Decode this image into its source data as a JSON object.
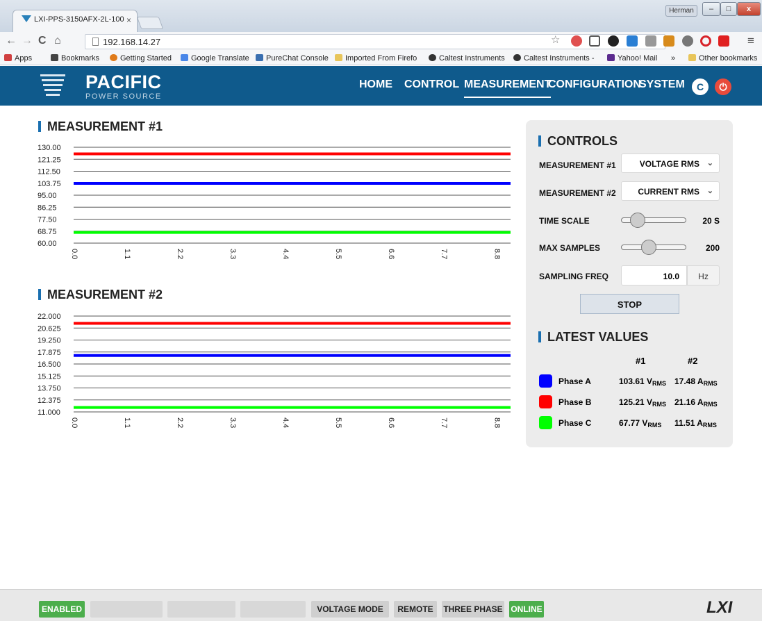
{
  "browser": {
    "tab_title": "LXI-PPS-3150AFX-2L-100",
    "tab_close": "×",
    "user_name": "Herman",
    "win_min": "–",
    "win_max": "□",
    "win_close": "x",
    "back": "←",
    "forward": "→",
    "reload": "C",
    "home": "⌂",
    "url": "192.168.14.27",
    "menu": "≡",
    "bookmarks": [
      {
        "label": "Apps",
        "icon": "apps-icon"
      },
      {
        "label": "Bookmarks",
        "icon": "star-icon"
      },
      {
        "label": "Getting Started",
        "icon": "firefox-icon"
      },
      {
        "label": "Google Translate",
        "icon": "translate-icon"
      },
      {
        "label": "PureChat Console",
        "icon": "chat-icon"
      },
      {
        "label": "Imported From Firefo",
        "icon": "folder-icon"
      },
      {
        "label": "Caltest Instruments",
        "icon": "caltest-icon"
      },
      {
        "label": "Caltest Instruments -",
        "icon": "caltest-icon"
      },
      {
        "label": "Yahoo! Mail",
        "icon": "yahoo-icon"
      },
      {
        "label": "»",
        "icon": ""
      },
      {
        "label": "Other bookmarks",
        "icon": "folder-icon"
      }
    ]
  },
  "header": {
    "brand": "PACIFIC",
    "brand_sub": "POWER SOURCE",
    "nav": [
      "HOME",
      "CONTROL",
      "MEASUREMENT",
      "CONFIGURATION",
      "SYSTEM"
    ],
    "active_nav": "MEASUREMENT",
    "refresh_glyph": "C",
    "power_glyph": "⏻"
  },
  "measurement1": {
    "title": "MEASUREMENT #1",
    "chart_data": {
      "type": "line",
      "y_ticks": [
        "130.00",
        "121.25",
        "112.50",
        "103.75",
        "95.00",
        "86.25",
        "77.50",
        "68.75",
        "60.00"
      ],
      "ylim": [
        60,
        130
      ],
      "x_ticks": [
        "0.0",
        "1.1",
        "2.2",
        "3.3",
        "4.4",
        "5.5",
        "6.6",
        "7.7",
        "8.8"
      ],
      "xlim": [
        0,
        9.1
      ],
      "series": [
        {
          "color": "#ff0000",
          "values": [
            125.2,
            125.2
          ]
        },
        {
          "color": "#0000ff",
          "values": [
            103.6,
            103.6
          ]
        },
        {
          "color": "#00ff00",
          "values": [
            67.8,
            67.8
          ]
        }
      ]
    }
  },
  "measurement2": {
    "title": "MEASUREMENT #2",
    "chart_data": {
      "type": "line",
      "y_ticks": [
        "22.000",
        "20.625",
        "19.250",
        "17.875",
        "16.500",
        "15.125",
        "13.750",
        "12.375",
        "11.000"
      ],
      "ylim": [
        11,
        22
      ],
      "x_ticks": [
        "0.0",
        "1.1",
        "2.2",
        "3.3",
        "4.4",
        "5.5",
        "6.6",
        "7.7",
        "8.8"
      ],
      "xlim": [
        0,
        9.1
      ],
      "series": [
        {
          "color": "#ff0000",
          "values": [
            21.16,
            21.16
          ]
        },
        {
          "color": "#0000ff",
          "values": [
            17.48,
            17.48
          ]
        },
        {
          "color": "#00ff00",
          "values": [
            11.51,
            11.51
          ]
        }
      ]
    }
  },
  "controls": {
    "title": "CONTROLS",
    "m1_label": "MEASUREMENT #1",
    "m1_value": "VOLTAGE RMS",
    "m2_label": "MEASUREMENT #2",
    "m2_value": "CURRENT RMS",
    "timescale_label": "TIME SCALE",
    "timescale_value": "20 S",
    "timescale_fraction": 0.2,
    "maxsamples_label": "MAX SAMPLES",
    "maxsamples_value": "200",
    "maxsamples_fraction": 0.42,
    "sampfreq_label": "SAMPLING FREQ",
    "sampfreq_value": "10.0",
    "sampfreq_unit": "Hz",
    "stop_label": "STOP"
  },
  "latest": {
    "title": "LATEST VALUES",
    "col1": "#1",
    "col2": "#2",
    "rows": [
      {
        "name": "Phase A",
        "color": "#0000ff",
        "v1": "103.61 V",
        "v1_sub": "RMS",
        "v2": "17.48 A",
        "v2_sub": "RMS"
      },
      {
        "name": "Phase B",
        "color": "#ff0000",
        "v1": "125.21 V",
        "v1_sub": "RMS",
        "v2": "21.16 A",
        "v2_sub": "RMS"
      },
      {
        "name": "Phase C",
        "color": "#00ff00",
        "v1": "67.77 V",
        "v1_sub": "RMS",
        "v2": "11.51 A",
        "v2_sub": "RMS"
      }
    ]
  },
  "footer": {
    "enabled": "ENABLED",
    "voltage_mode": "VOLTAGE MODE",
    "remote": "REMOTE",
    "three_phase": "THREE PHASE",
    "online": "ONLINE",
    "lxi": "LXI"
  }
}
